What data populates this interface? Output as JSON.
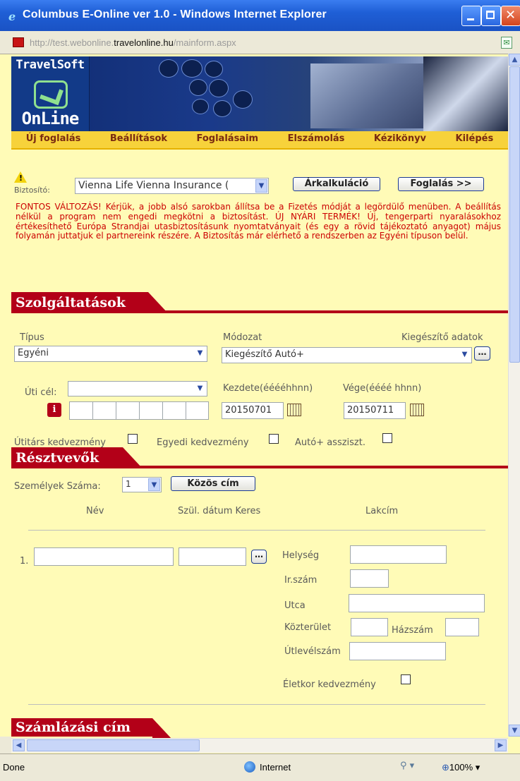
{
  "window": {
    "title": "Columbus E-Online ver 1.0 - Windows Internet Explorer",
    "url_prefix": "http://test.webonline.",
    "url_domain": "travelonline.hu",
    "url_path": "/mainform.aspx"
  },
  "logo": {
    "line1": "TravelSoft",
    "line2": "OnLine"
  },
  "menu": [
    "Új foglalás",
    "Beállítások",
    "Foglalásaim",
    "Elszámolás",
    "Kézikönyv",
    "Kilépés"
  ],
  "insurer": {
    "label": "Biztosító:",
    "selected": "Vienna Life Vienna Insurance (",
    "calc_button": "Árkalkuláció",
    "book_button": "Foglalás >>",
    "notice": "FONTOS VÁLTOZÁS! Kérjük, a jobb alsó sarokban állítsa be a Fizetés módját a legördülő menüben. A beállítás nélkül a program nem engedi megkötni a biztosítást. ÚJ NYÁRI TERMÉK! Új, tengerparti nyaralásokhoz értékesíthető Európa Strandjai utasbiztosításunk nyomtatványait (és egy a rövid tájékoztató anyagot) május folyamán juttatjuk el partnereink részére. A Biztosítás már elérhető a rendszerben az Egyéni típuson belül."
  },
  "services": {
    "heading": "Szolgáltatások",
    "type_label": "Típus",
    "type_value": "Egyéni",
    "plan_label": "Módozat",
    "plan_value": "Kiegészítő Autó+",
    "extra_label": "Kiegészítő adatok",
    "dest_label": "Úti cél:",
    "dest_value": "",
    "start_label": "Kezdete(ééééhhnn)",
    "start_value": "20150701",
    "end_label": "Vége(éééé hhnn)",
    "end_value": "20150711",
    "companion_discount": "Útitárs kedvezmény",
    "individual_discount": "Egyedi kedvezmény",
    "auto_assist": "Autó+ assziszt."
  },
  "participants": {
    "heading": "Résztvevők",
    "count_label": "Személyek Száma:",
    "count_value": "1",
    "common_address_button": "Közös cím",
    "col_name": "Név",
    "col_birth": "Szül. dátum Keres",
    "col_address": "Lakcím",
    "row_number": "1.",
    "city_label": "Helység",
    "zip_label": "Ir.szám",
    "street_label": "Utca",
    "public_area_label": "Közterület",
    "house_no_label": "Házszám",
    "passport_label": "Útlevélszám",
    "age_discount_label": "Életkor kedvezmény"
  },
  "billing": {
    "heading": "Számlázási cím"
  },
  "status": {
    "text": "Done",
    "zone": "Internet",
    "zoom": "100%"
  }
}
